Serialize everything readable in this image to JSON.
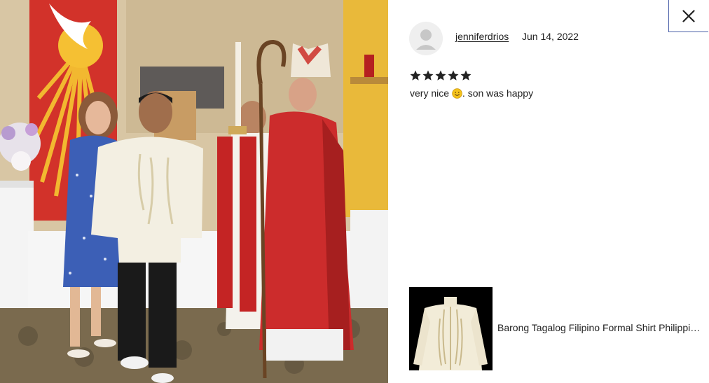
{
  "review": {
    "reviewer_name": "jenniferdrios",
    "date": "Jun 14, 2022",
    "rating": 5,
    "rating_max": 5,
    "text_before_emoji": "very nice ",
    "emoji": "smiling-face-emoji",
    "text_after_emoji": ". son was happy"
  },
  "photo": {
    "icon": "review-photo"
  },
  "product": {
    "title": "Barong Tagalog Filipino Formal Shirt Philippine National Costume",
    "icon": "product-thumbnail"
  },
  "controls": {
    "close_icon": "close-icon"
  },
  "colors": {
    "accent_border": "#4a5fa8",
    "text": "#222222",
    "star": "#222222"
  }
}
